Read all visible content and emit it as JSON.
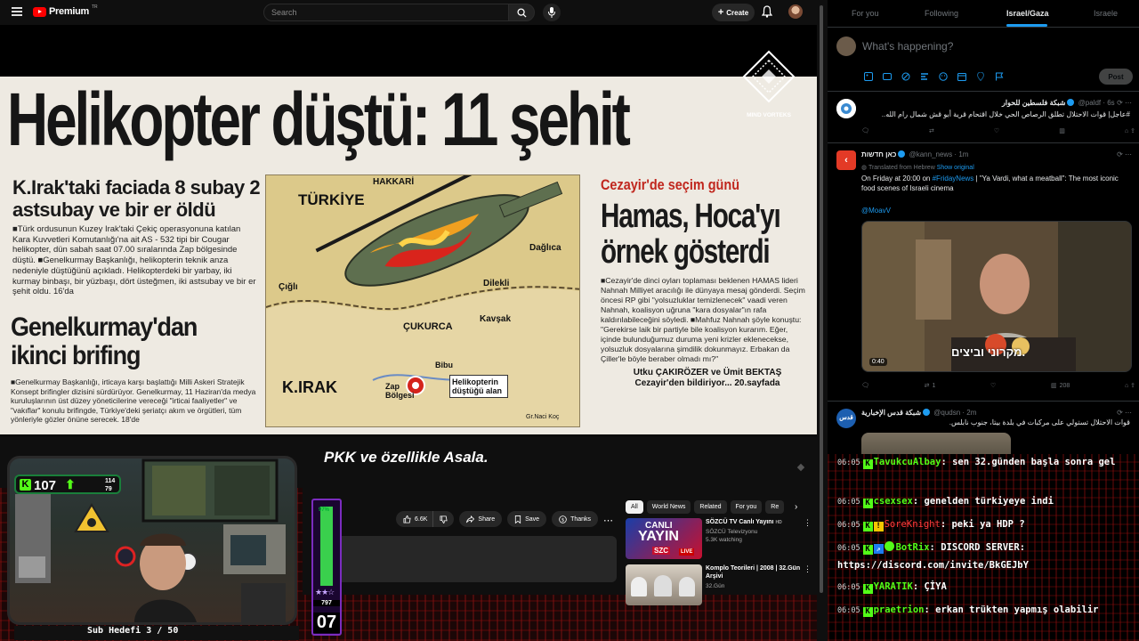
{
  "youtube": {
    "logo_text": "Premium",
    "logo_sup": "TR",
    "search_placeholder": "Search",
    "create_label": "Create",
    "video": {
      "headline": "Helikopter düştü: 11 şehit",
      "sub1": "K.Irak'taki faciada 8 subay 2 astsubay ve bir er öldü",
      "body1": "■Türk ordusunun Kuzey Irak'taki Çekiç operasyonuna katılan Kara Kuvvetleri Komutanlığı'na ait AS - 532 tipi bir Cougar helikopter, dün sabah saat 07.00 sıralarında Zap bölgesinde düştü. ■Genelkurmay Başkanlığı, helikopterin teknik anza nedeniyle düştüğünü açıkladı. Helikopterdeki bir yarbay, iki kurmay binbaşı, bir yüzbaşı, dört üsteğmen, iki astsubay ve bir er şehit oldu. 16'da",
      "sub2_line1": "Genelkurmay'dan",
      "sub2_line2": "ikinci brifing",
      "body2": "■Genelkurmay Başkanlığı, irticaya karşı başlattığı Milli Askeri Stratejik Konsept brifingler dizisini sürdürüyor. Genelkurmay, 11 Haziran'da medya kuruluşlarının üst düzey yöneticilerine vereceği \"irticai faaliyetler\" ve \"vakıflar\" konulu brifingde, Türkiye'deki şeriatçı akım ve örgütleri, tüm yönleriyle gözler önüne serecek. 18'de",
      "map_labels": [
        "TÜRKİYE",
        "HAKKARİ",
        "Dağlıca",
        "Çığlı",
        "Dilekli",
        "ÇUKURCA",
        "Kavşak",
        "K.IRAK",
        "Zap Bölgesi",
        "Bibu",
        "Helikopterin düştüğü alan",
        "Gr.Naci Koç"
      ],
      "right_head": "Cezayir'de seçim günü",
      "right_big1": "Hamas, Hoca'yı",
      "right_big2": "örnek gösterdi",
      "right_body": "■Cezayir'de dinci oyları toplaması beklenen HAMAS lideri Nahnah Milliyet aracılığı ile dünyaya mesaj gönderdi. Seçim öncesi RP gibi \"yolsuzluklar temizlenecek\" vaadi veren Nahnah, koalisyon uğruna \"kara dosyalar\"ın rafa kaldırılabileceğini söyledi. ■Mahfuz Nahnah şöyle konuştu: \"Gerekirse laik bir partiyle bile koalisyon kurarım. Eğer, içinde bulunduğumuz duruma yeni krizler eklenecekse, yolsuzluk dosyalarına şimdilik dokunmayız. Erbakan da Çiller'le böyle beraber olmadı mı?\"",
      "right_credit1": "Utku ÇAKIRÖZER ve Ümit BEKTAŞ",
      "right_credit2": "Cezayir'den bildiriyor... 20.sayfada",
      "watermark": "MIND VORTEKS",
      "caption": "PKK ve özellikle Asala."
    },
    "actions": {
      "like_count": "6.6K",
      "share_label": "Share",
      "save_label": "Save",
      "thanks_label": "Thanks"
    },
    "chips": [
      "All",
      "World News",
      "Related",
      "For you",
      "Re"
    ],
    "recommended": [
      {
        "title": "SÖZCÜ TV Canlı Yayını",
        "hd": "HD",
        "channel": "SÖZCÜ Televizyonu",
        "meta": "5.3K watching",
        "thumb_text1": "CANLI",
        "thumb_text2": "YAYIN",
        "thumb_live": "LIVE",
        "thumb_brand": "SZC"
      },
      {
        "title": "Komplo Teorileri | 2008 | 32.Gün Arşivi",
        "channel": "32.Gün"
      }
    ]
  },
  "stream_overlay": {
    "sub_count": "107",
    "sub_mini1": "114",
    "sub_mini2": "79",
    "sub_goal": "Sub Hedefi 3 / 50",
    "meter_pct": "97%",
    "meter_fraction": 0.97,
    "meter_val": "797",
    "meter_big": "07"
  },
  "twitter": {
    "tabs": [
      "For you",
      "Following",
      "Israel/Gaza",
      "Israele"
    ],
    "active_tab": "Israel/Gaza",
    "compose_placeholder": "What's happening?",
    "post_label": "Post",
    "tweets": [
      {
        "name": "شبكة فلسطين للحوار",
        "handle": "@paldf · 6s",
        "text": "#عاجل| قوات الاحتلال تطلق الرصاص الحي خلال اقتحام قرية أبو قش شمال رام الله.."
      },
      {
        "name": "כאן חדשות",
        "handle": "@kann_news · 1m",
        "translated": "Translated from Hebrew",
        "show_original": "Show original",
        "text1": "On Friday at 20:00 on ",
        "hashtag": "#FridayNews",
        "text2": " | \"Ya Vardi, what a meatball\": The most iconic food scenes of Israeli cinema",
        "mention": "@MoavV",
        "video_time": "0:40",
        "video_sub": "מקרוני וביצים.",
        "retweets": "1",
        "views": "208"
      },
      {
        "name": "شبكة قدس الإخبارية",
        "handle": "@qudsn · 2m",
        "text": "قوات الاحتلال تستولي على مركبات في بلدة بيتا، جنوب نابلس."
      }
    ]
  },
  "chat": {
    "messages": [
      {
        "time": "06:05",
        "user": "TavukcuAlbay",
        "user_color": "#53fc18",
        "text": "sen 32.günden başla sonra gel"
      },
      {
        "time": "06:05",
        "user": "csexsex",
        "user_color": "#53fc18",
        "text": "genelden türkiyeye indi"
      },
      {
        "time": "06:05",
        "user": "SoreKnight",
        "user_color": "#ff3b3b",
        "text": "peki ya HDP ?"
      },
      {
        "time": "06:05",
        "user": "BotRix",
        "user_color": "#53fc18",
        "text": "DISCORD SERVER: https://discord.com/invite/BkGEJbY"
      },
      {
        "time": "06:05",
        "user": "YARATIK",
        "user_color": "#53fc18",
        "text": "ÇİYA"
      },
      {
        "time": "06:05",
        "user": "praetrion",
        "user_color": "#53fc18",
        "text": "erkan trükten yapmış olabilir"
      }
    ]
  }
}
